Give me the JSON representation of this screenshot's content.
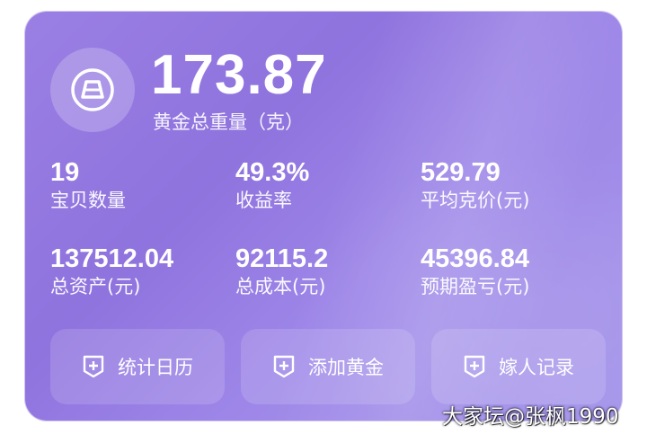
{
  "summary": {
    "total_weight": "173.87",
    "total_weight_label": "黄金总重量（克）",
    "icon": "gold-bar-icon"
  },
  "stats": [
    {
      "value": "19",
      "label": "宝贝数量"
    },
    {
      "value": "49.3%",
      "label": "收益率"
    },
    {
      "value": "529.79",
      "label": "平均克价(元)"
    },
    {
      "value": "137512.04",
      "label": "总资产(元)"
    },
    {
      "value": "92115.2",
      "label": "总成本(元)"
    },
    {
      "value": "45396.84",
      "label": "预期盈亏(元)"
    }
  ],
  "buttons": [
    {
      "label": "统计日历",
      "icon": "add-box-icon"
    },
    {
      "label": "添加黄金",
      "icon": "add-box-icon"
    },
    {
      "label": "嫁人记录",
      "icon": "add-box-icon"
    }
  ],
  "watermark": "大家坛@张枫1990",
  "colors": {
    "card_gradient_start": "#9a7fe4",
    "card_gradient_end": "#a595ea",
    "text": "#ffffff"
  }
}
